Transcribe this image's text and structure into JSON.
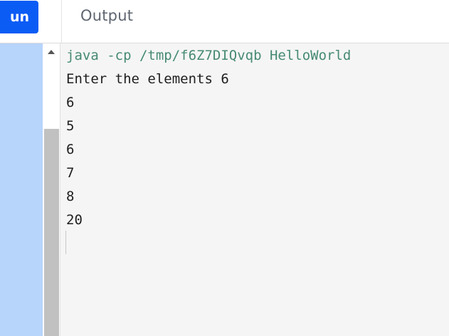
{
  "header": {
    "run_label": "un",
    "output_title": "Output"
  },
  "output": {
    "command": "java -cp /tmp/f6Z7DIQvqb HelloWorld",
    "lines": [
      "Enter the elements 6",
      "6",
      "5",
      "6",
      "7",
      "8",
      "20"
    ]
  },
  "colors": {
    "run_button": "#0b5cf5",
    "command_text": "#468a72",
    "left_panel": "#b7d4fb"
  }
}
